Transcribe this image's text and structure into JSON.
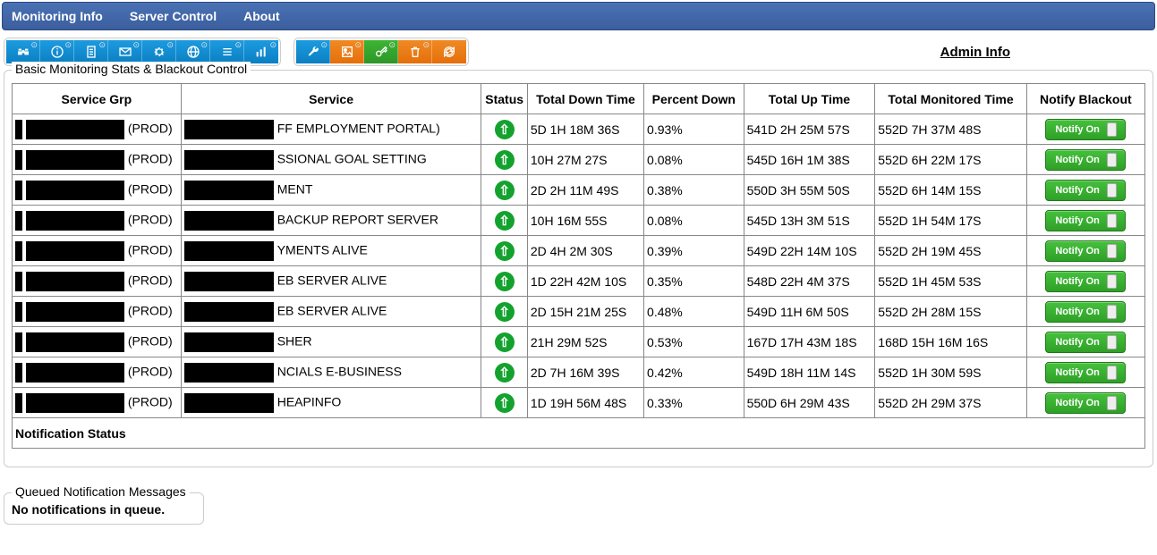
{
  "nav": {
    "items": [
      "Monitoring Info",
      "Server Control",
      "About"
    ]
  },
  "admin_link": "Admin Info",
  "panel_title": "Basic Monitoring Stats & Blackout Control",
  "headers": [
    "Service Grp",
    "Service",
    "Status",
    "Total Down Time",
    "Percent Down",
    "Total Up Time",
    "Total Monitored Time",
    "Notify Blackout"
  ],
  "notify_label": "Notify On",
  "rows": [
    {
      "grp_suffix": "(PROD)",
      "svc_suffix": "FF EMPLOYMENT PORTAL)",
      "down": "5D 1H 18M 36S",
      "pct": "0.93%",
      "up": "541D 2H 25M 57S",
      "mon": "552D 7H 37M 48S"
    },
    {
      "grp_suffix": "(PROD)",
      "svc_suffix": "SSIONAL GOAL SETTING",
      "down": "10H 27M 27S",
      "pct": "0.08%",
      "up": "545D 16H 1M 38S",
      "mon": "552D 6H 22M 17S"
    },
    {
      "grp_suffix": "(PROD)",
      "svc_suffix": "MENT",
      "down": "2D 2H 11M 49S",
      "pct": "0.38%",
      "up": "550D 3H 55M 50S",
      "mon": "552D 6H 14M 15S"
    },
    {
      "grp_suffix": "(PROD)",
      "svc_suffix": "BACKUP REPORT SERVER",
      "down": "10H 16M 55S",
      "pct": "0.08%",
      "up": "545D 13H 3M 51S",
      "mon": "552D 1H 54M 17S"
    },
    {
      "grp_suffix": "(PROD)",
      "svc_suffix": "YMENTS ALIVE",
      "down": "2D 4H 2M 30S",
      "pct": "0.39%",
      "up": "549D 22H 14M 10S",
      "mon": "552D 2H 19M 45S"
    },
    {
      "grp_suffix": "(PROD)",
      "svc_suffix": "EB SERVER ALIVE",
      "down": "1D 22H 42M 10S",
      "pct": "0.35%",
      "up": "548D 22H 4M 37S",
      "mon": "552D 1H 45M 53S"
    },
    {
      "grp_suffix": "(PROD)",
      "svc_suffix": "EB SERVER ALIVE",
      "down": "2D 15H 21M 25S",
      "pct": "0.48%",
      "up": "549D 11H 6M 50S",
      "mon": "552D 2H 28M 15S"
    },
    {
      "grp_suffix": "(PROD)",
      "svc_suffix": "SHER",
      "down": "21H 29M 52S",
      "pct": "0.53%",
      "up": "167D 17H 43M 18S",
      "mon": "168D 15H 16M 16S"
    },
    {
      "grp_suffix": "(PROD)",
      "svc_suffix": "NCIALS E-BUSINESS",
      "down": "2D 7H 16M 39S",
      "pct": "0.42%",
      "up": "549D 18H 11M 14S",
      "mon": "552D 1H 30M 59S"
    },
    {
      "grp_suffix": "(PROD)",
      "svc_suffix": "HEAPINFO",
      "down": "1D 19H 56M 48S",
      "pct": "0.33%",
      "up": "550D 6H 29M 43S",
      "mon": "552D 2H 29M 37S"
    }
  ],
  "section_label": "Notification Status",
  "queued": {
    "title": "Queued Notification Messages",
    "msg": "No notifications in queue."
  },
  "icons": {
    "group1": [
      "binoculars",
      "info",
      "document",
      "mail",
      "gear",
      "globe",
      "list",
      "chart"
    ],
    "group2": [
      "wrench",
      "image",
      "key",
      "trash",
      "refresh"
    ]
  }
}
